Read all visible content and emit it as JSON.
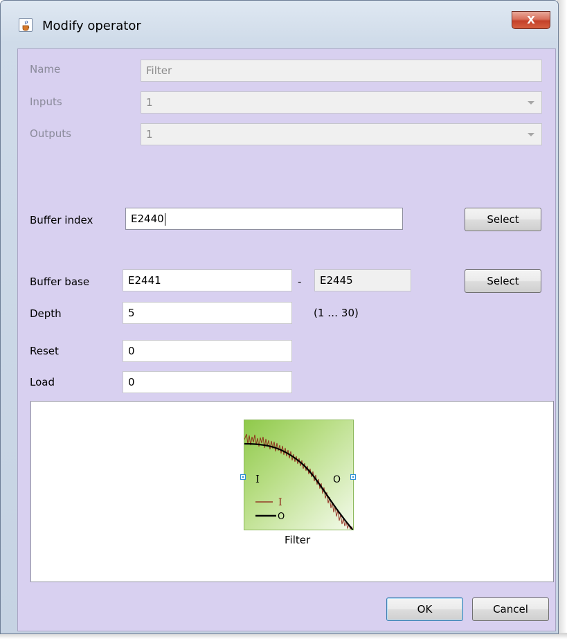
{
  "window": {
    "title": "Modify operator",
    "close_glyph": "X",
    "icon": "java-cup-icon"
  },
  "form": {
    "name": {
      "label": "Name",
      "value": "Filter"
    },
    "inputs": {
      "label": "Inputs",
      "value": "1"
    },
    "outputs": {
      "label": "Outputs",
      "value": "1"
    },
    "buffer_index": {
      "label": "Buffer index",
      "value": "E2440",
      "select_label": "Select"
    },
    "buffer_base": {
      "label": "Buffer base",
      "from": "E2441",
      "separator": "-",
      "to": "E2445",
      "select_label": "Select"
    },
    "depth": {
      "label": "Depth",
      "value": "5",
      "range": "(1 … 30)"
    },
    "reset": {
      "label": "Reset",
      "value": "0"
    },
    "load": {
      "label": "Load",
      "value": "0"
    }
  },
  "preview": {
    "caption": "Filter",
    "port_in_label": "I",
    "port_out_label": "O",
    "legend_in": "I",
    "legend_out": "O",
    "colors": {
      "raw_signal": "#8b1a10",
      "filtered_signal": "#000000",
      "box_start": "#8fc94a",
      "box_end": "#f3faea"
    }
  },
  "buttons": {
    "ok": "OK",
    "cancel": "Cancel"
  },
  "colors": {
    "panel": "#d8d0f0",
    "close": "#c4412a",
    "default_button_border": "#3c7fb1"
  }
}
